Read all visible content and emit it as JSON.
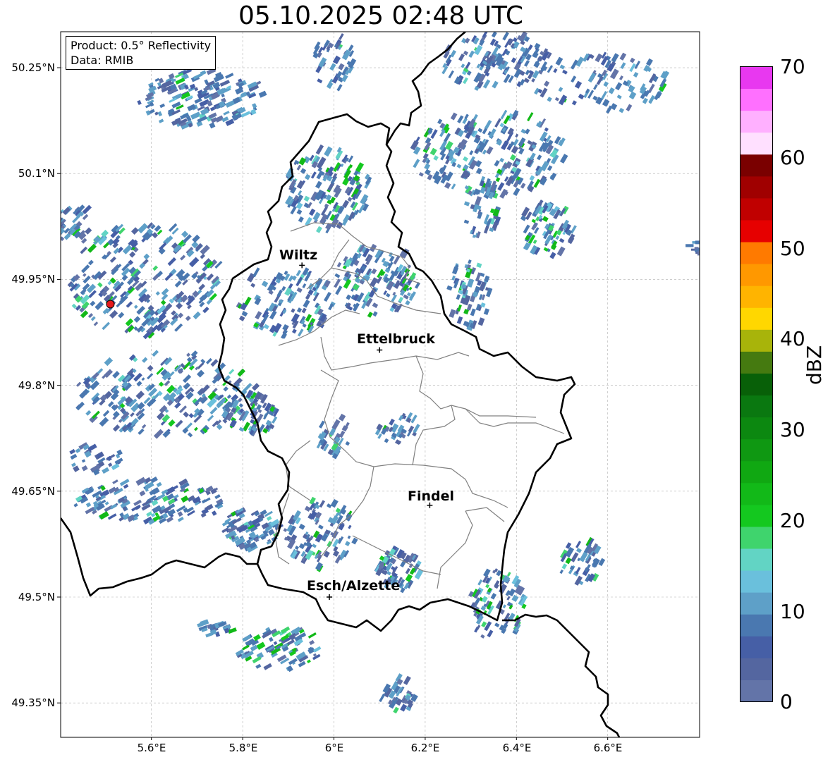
{
  "title": "05.10.2025 02:48 UTC",
  "info": {
    "product": "Product: 0.5° Reflectivity",
    "data": "Data: RMIB"
  },
  "axes": {
    "y_ticks": [
      "50.25°N",
      "50.1°N",
      "49.95°N",
      "49.8°N",
      "49.65°N",
      "49.5°N",
      "49.35°N"
    ],
    "x_ticks": [
      "5.6°E",
      "5.8°E",
      "6°E",
      "6.2°E",
      "6.4°E",
      "6.6°E"
    ]
  },
  "cities": [
    {
      "name": "Wiltz",
      "lon": 5.93,
      "lat": 49.97
    },
    {
      "name": "Ettelbruck",
      "lon": 6.1,
      "lat": 49.85
    },
    {
      "name": "Findel",
      "lon": 6.21,
      "lat": 49.63
    },
    {
      "name": "Esch/Alzette",
      "lon": 5.99,
      "lat": 49.5
    }
  ],
  "radar_site": {
    "lon": 5.51,
    "lat": 49.915,
    "color": "#e41a1c"
  },
  "colorbar": {
    "label": "dBZ",
    "ticks": [
      "0",
      "10",
      "20",
      "30",
      "40",
      "50",
      "60",
      "70"
    ],
    "min": 0,
    "max": 70,
    "step": 2.5,
    "colors": [
      "#6374a8",
      "#5466a0",
      "#465fa6",
      "#4a78b0",
      "#5ea0c8",
      "#6ac0dc",
      "#62d4c4",
      "#3fd46d",
      "#14c81f",
      "#12b918",
      "#10a812",
      "#0f9812",
      "#0c8810",
      "#0a7810",
      "#086008",
      "#457a10",
      "#a8b40a",
      "#ffd700",
      "#ffb400",
      "#ff9800",
      "#ff7a00",
      "#e60000",
      "#c00000",
      "#a00000",
      "#7a0000",
      "#ffe0ff",
      "#ffb0ff",
      "#ff70ff",
      "#e838f0"
    ]
  },
  "colors": {
    "border_country": "#000000",
    "border_canton": "#808080",
    "grid": "#b0b0b0"
  }
}
